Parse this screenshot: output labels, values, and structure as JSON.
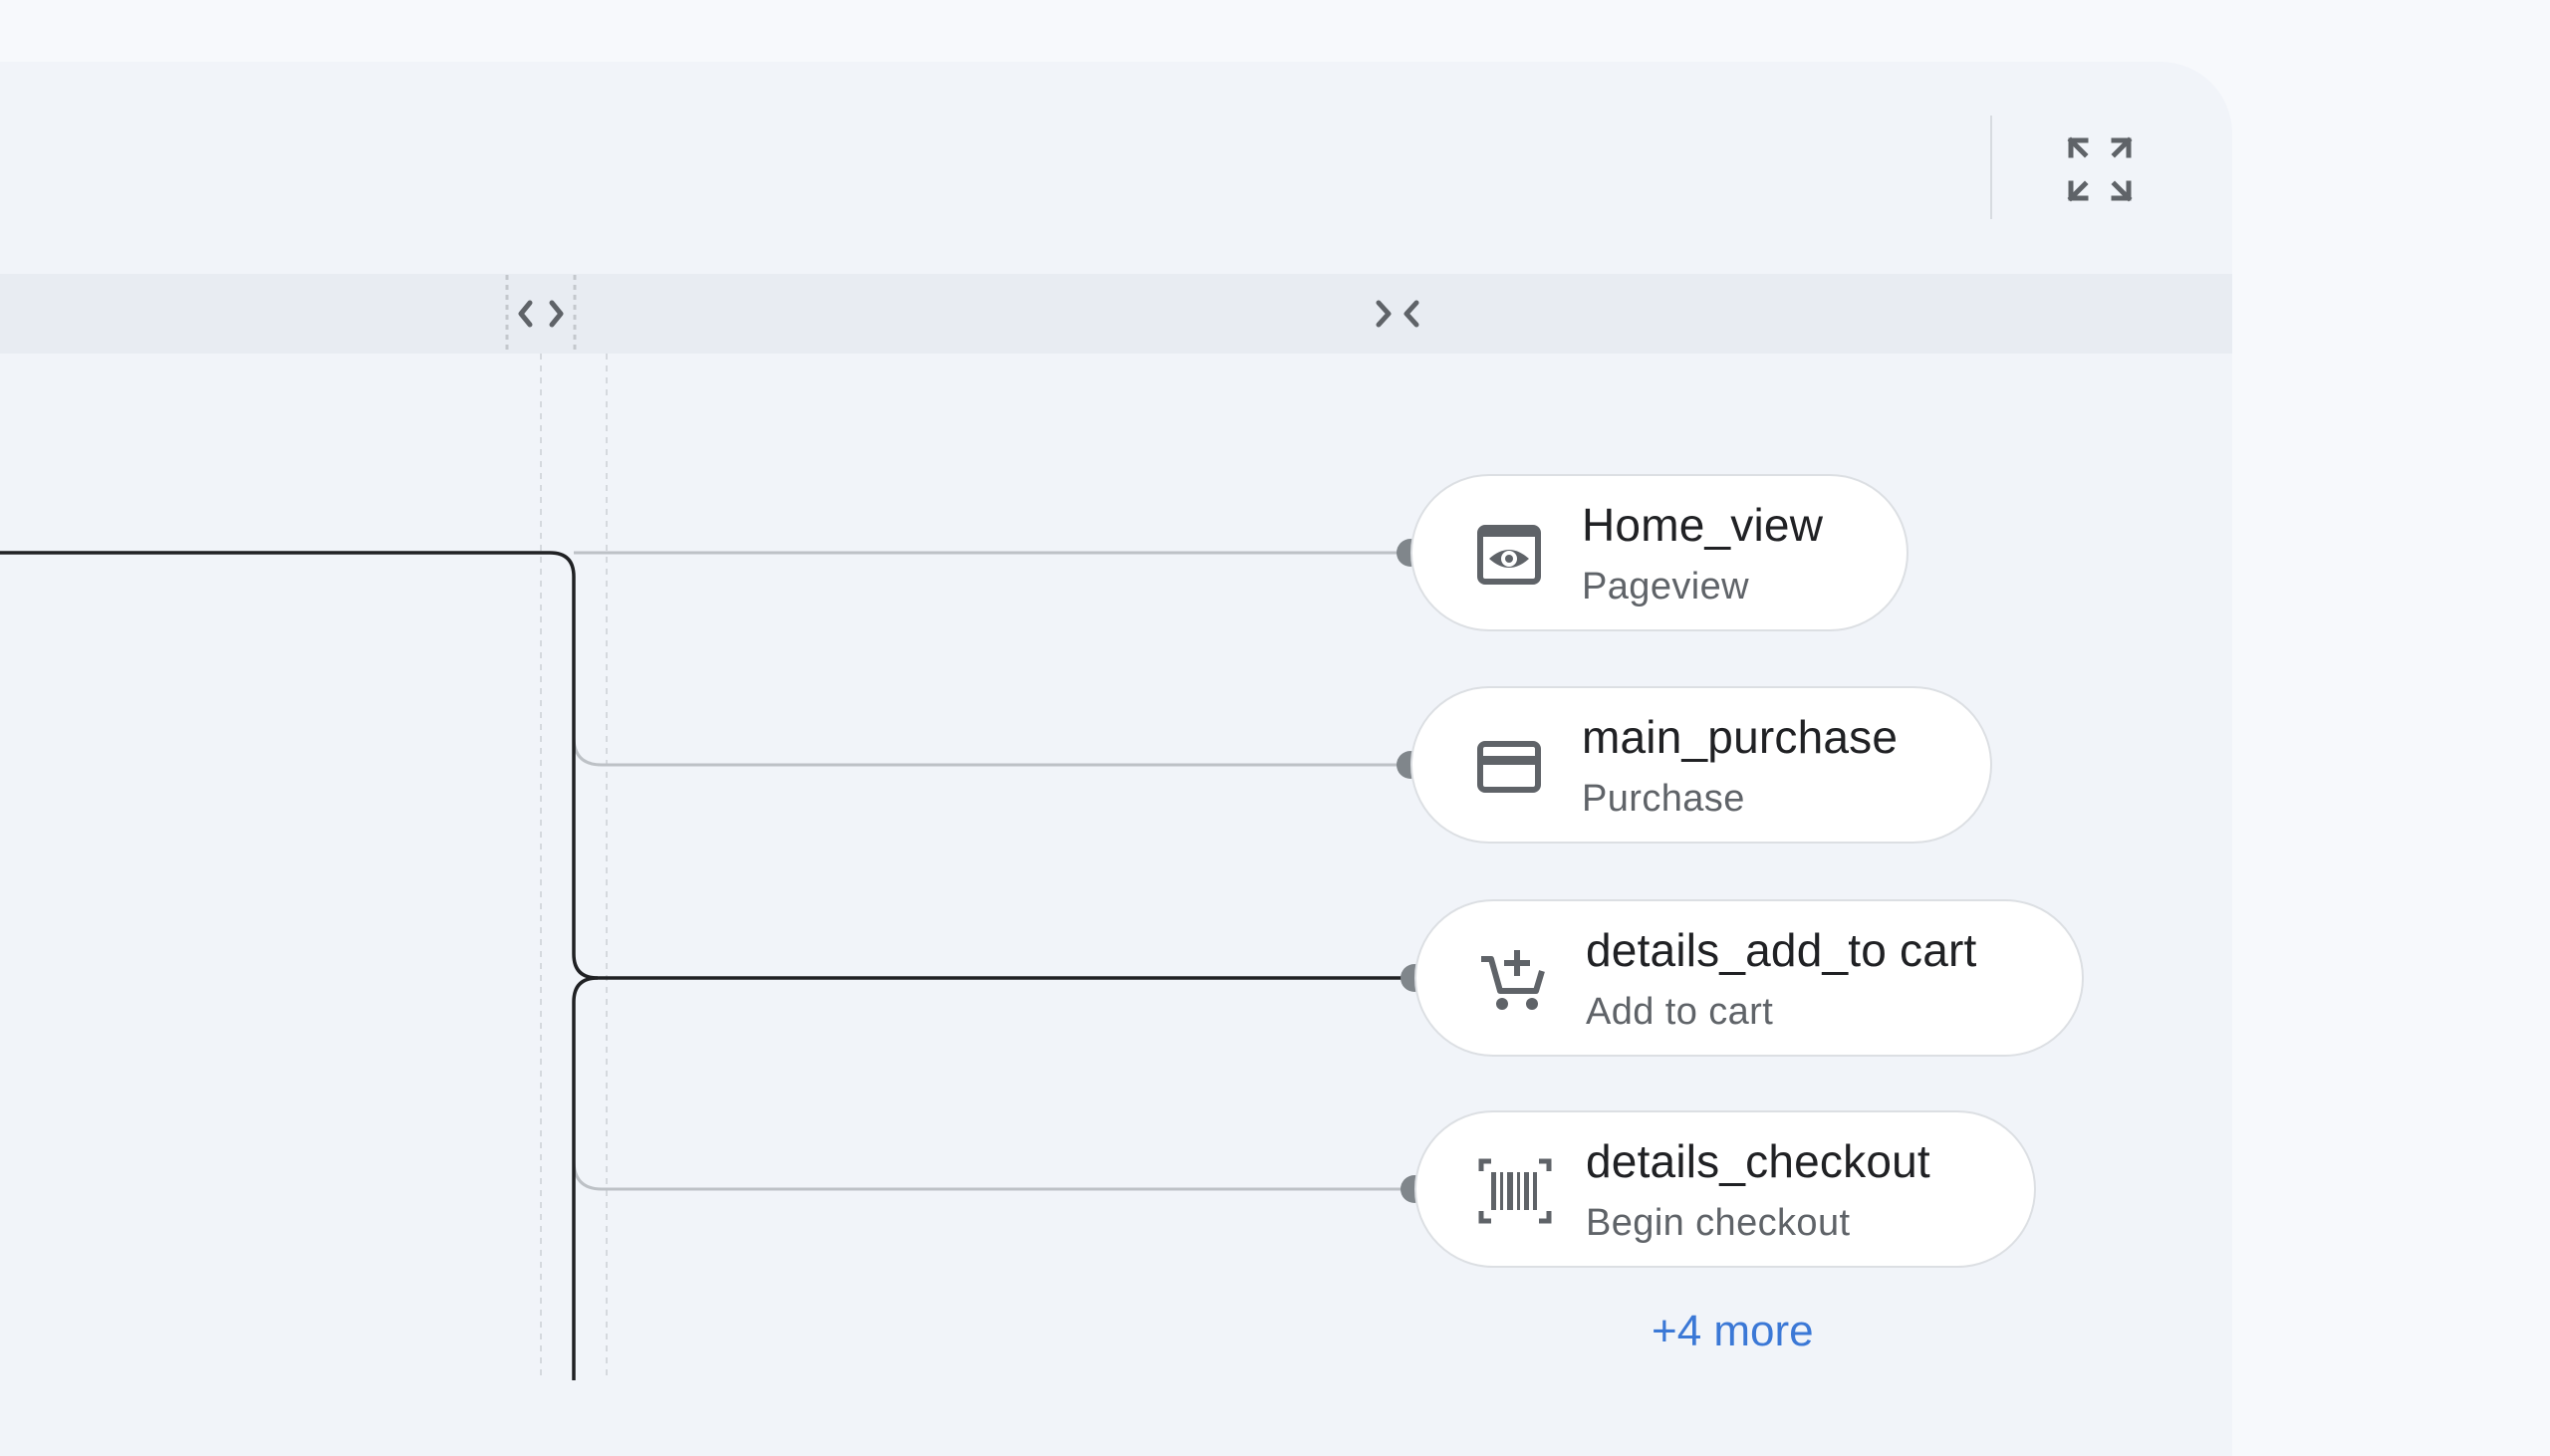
{
  "nodes": [
    {
      "name": "Home_view",
      "type": "Pageview",
      "icon": "pageview-icon"
    },
    {
      "name": "main_purchase",
      "type": "Purchase",
      "icon": "credit-card-icon"
    },
    {
      "name": "details_add_to cart",
      "type": "Add to cart",
      "icon": "add-to-cart-icon"
    },
    {
      "name": "details_checkout",
      "type": "Begin checkout",
      "icon": "barcode-icon"
    }
  ],
  "more_link": "+4 more",
  "colors": {
    "panel_bg": "#f1f4f9",
    "header_bg": "#e8ecf2",
    "dark_line": "#202124",
    "light_line": "#bdc1c6",
    "connector_dot": "#80868b",
    "icon": "#5f6368",
    "link": "#3b78d6"
  }
}
